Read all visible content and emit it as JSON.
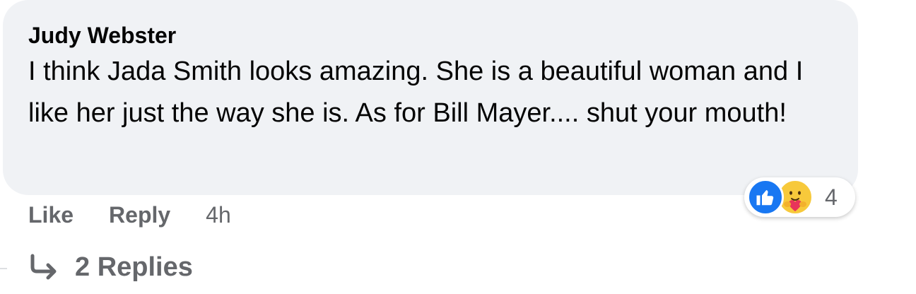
{
  "comment": {
    "author": "Judy Webster",
    "text": "I think Jada Smith looks amazing. She is a beautiful woman and I like her just the way she is. As for Bill Mayer.... shut your mouth!",
    "actions": {
      "like_label": "Like",
      "reply_label": "Reply",
      "time": "4h"
    },
    "reactions": {
      "icons": [
        "like-icon",
        "care-icon"
      ],
      "count": "4"
    },
    "replies_label": "2 Replies"
  },
  "colors": {
    "bubble_bg": "#f0f2f5",
    "text": "#050505",
    "secondary_text": "#65676b",
    "like_blue": "#1877f2",
    "care_yellow": "#f7c93b",
    "care_heart": "#e8345a"
  }
}
